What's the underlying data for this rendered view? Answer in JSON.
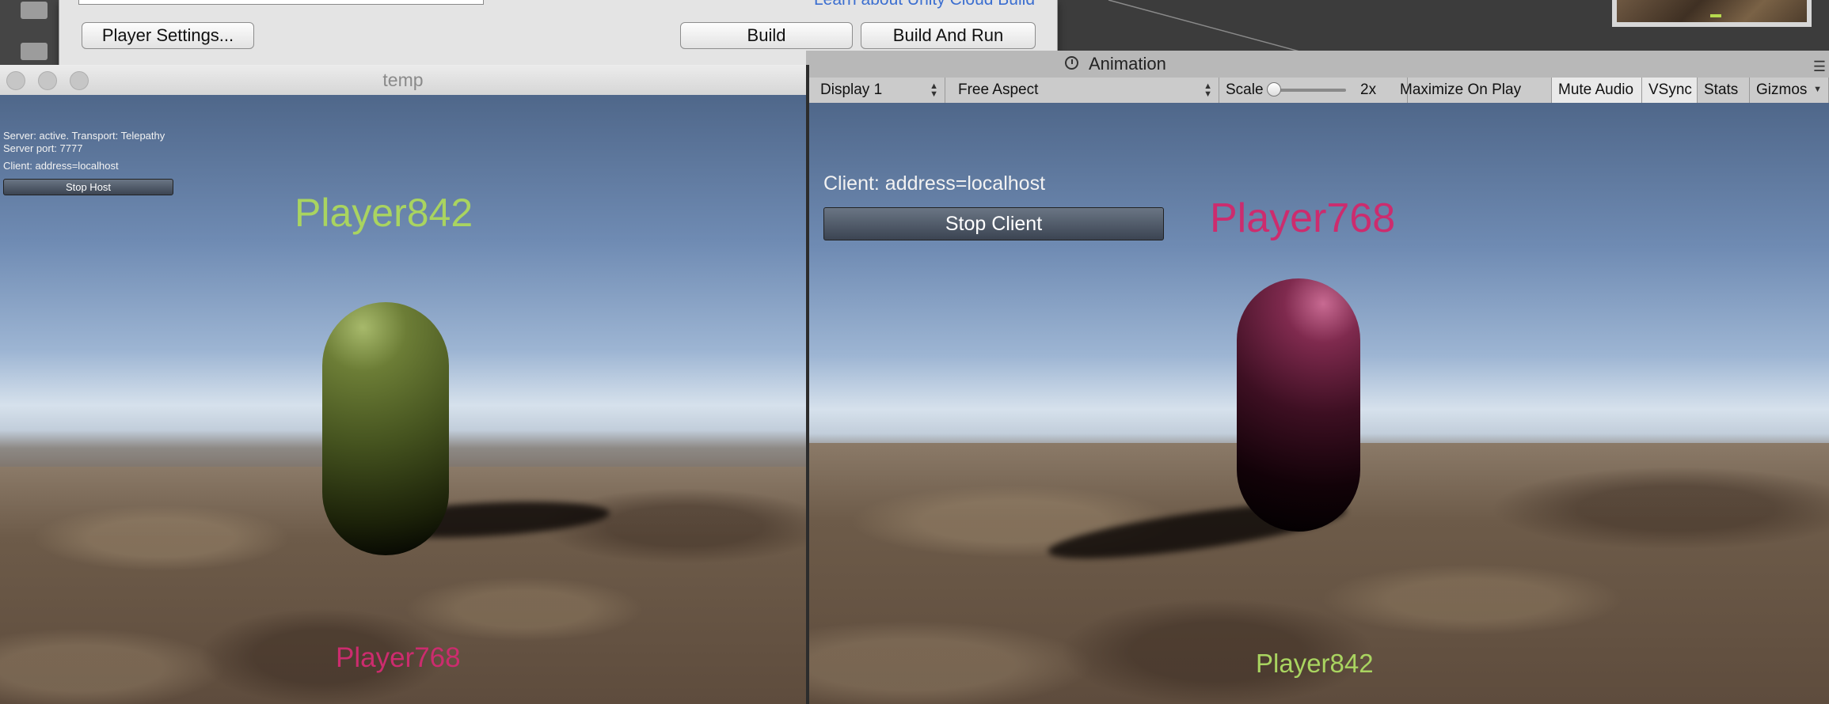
{
  "build_dialog": {
    "cloud_link": "Learn about Unity Cloud Build",
    "player_settings_label": "Player Settings...",
    "build_label": "Build",
    "build_and_run_label": "Build And Run"
  },
  "standalone_window": {
    "title": "temp",
    "hud": {
      "server_status": "Server: active. Transport: Telepathy",
      "server_port": "Server port: 7777",
      "client_address": "Client: address=localhost",
      "stop_host_label": "Stop Host"
    },
    "player_labels": {
      "top": "Player842",
      "bottom": "Player768"
    }
  },
  "editor_game_view": {
    "tab_label": "Animation",
    "toolbar": {
      "display": "Display 1",
      "aspect": "Free Aspect",
      "scale_label": "Scale",
      "scale_value": "2x",
      "maximize_on_play": "Maximize On Play",
      "mute_audio": "Mute Audio",
      "vsync": "VSync",
      "stats": "Stats",
      "gizmos": "Gizmos"
    },
    "hud": {
      "client_address": "Client: address=localhost",
      "stop_client_label": "Stop Client"
    },
    "player_labels": {
      "top": "Player768",
      "bottom": "Player842"
    }
  },
  "colors": {
    "player842": "#a9d460",
    "player768": "#cc2c6e",
    "link": "#3c6fd0"
  },
  "icons": [
    "folder-icon",
    "clock-icon",
    "menu-icon",
    "dropdown-arrow-icon"
  ]
}
